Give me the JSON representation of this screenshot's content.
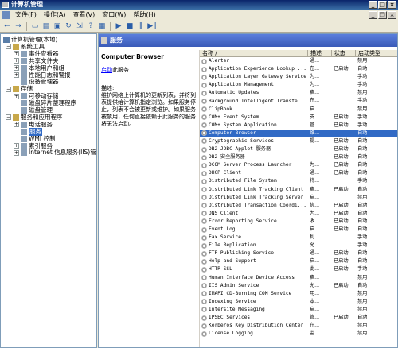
{
  "window": {
    "title": "计算机管理"
  },
  "menubar": {
    "items": [
      "文件(F)",
      "操作(A)",
      "查看(V)",
      "窗口(W)",
      "帮助(H)"
    ]
  },
  "tree": {
    "items": [
      {
        "label": "计算机管理(本地)",
        "expander": "",
        "level": 0
      },
      {
        "label": "系统工具",
        "expander": "−",
        "level": 1
      },
      {
        "label": "事件查看器",
        "expander": "+",
        "level": 2
      },
      {
        "label": "共享文件夹",
        "expander": "+",
        "level": 2
      },
      {
        "label": "本地用户和组",
        "expander": "+",
        "level": 2
      },
      {
        "label": "性能日志和警报",
        "expander": "+",
        "level": 2
      },
      {
        "label": "设备管理器",
        "expander": "",
        "level": 2
      },
      {
        "label": "存储",
        "expander": "−",
        "level": 1
      },
      {
        "label": "可移动存储",
        "expander": "+",
        "level": 2
      },
      {
        "label": "磁盘碎片整理程序",
        "expander": "",
        "level": 2
      },
      {
        "label": "磁盘管理",
        "expander": "",
        "level": 2
      },
      {
        "label": "服务和应用程序",
        "expander": "−",
        "level": 1
      },
      {
        "label": "电话服务",
        "expander": "+",
        "level": 2
      },
      {
        "label": "服务",
        "expander": "",
        "level": 2,
        "selected": true
      },
      {
        "label": "WMI 控制",
        "expander": "",
        "level": 2
      },
      {
        "label": "索引服务",
        "expander": "+",
        "level": 2
      },
      {
        "label": "Internet 信息服务(IIS)管",
        "expander": "+",
        "level": 2
      }
    ]
  },
  "pane": {
    "title": "服务"
  },
  "description": {
    "service_name": "Computer Browser",
    "start_link": "启动",
    "start_suffix": "此服务",
    "label": "描述:",
    "text": "维护网络上计算机的更新列表，并将列表提供给计算机指定浏览。如果服务停止，列表不会被更新或维护。如果服务被禁用，任何直接依赖于此服务的服务将无法启动。"
  },
  "list": {
    "headers": {
      "name": "名称 /",
      "desc": "描述",
      "status": "状态",
      "startup": "启动类型"
    },
    "rows": [
      {
        "name": "Alerter",
        "desc": "通...",
        "status": "",
        "startup": "禁用"
      },
      {
        "name": "Application Experience Lookup ...",
        "desc": "在...",
        "status": "已启动",
        "startup": "自动"
      },
      {
        "name": "Application Layer Gateway Service",
        "desc": "为...",
        "status": "",
        "startup": "手动"
      },
      {
        "name": "Application Management",
        "desc": "为...",
        "status": "",
        "startup": "手动"
      },
      {
        "name": "Automatic Updates",
        "desc": "启...",
        "status": "",
        "startup": "禁用"
      },
      {
        "name": "Background Intelligent Transfe...",
        "desc": "在...",
        "status": "",
        "startup": "手动"
      },
      {
        "name": "ClipBook",
        "desc": "启...",
        "status": "",
        "startup": "禁用"
      },
      {
        "name": "COM+ Event System",
        "desc": "支...",
        "status": "已启动",
        "startup": "手动"
      },
      {
        "name": "COM+ System Application",
        "desc": "管...",
        "status": "已启动",
        "startup": "手动"
      },
      {
        "name": "Computer Browser",
        "desc": "维...",
        "status": "",
        "startup": "自动",
        "selected": true
      },
      {
        "name": "Cryptographic Services",
        "desc": "提...",
        "status": "已启动",
        "startup": "自动"
      },
      {
        "name": "DB2 JDBC Applet 服务器",
        "desc": "",
        "status": "已启动",
        "startup": "自动"
      },
      {
        "name": "DB2 安全服务器",
        "desc": "",
        "status": "已启动",
        "startup": "自动"
      },
      {
        "name": "DCOM Server Process Launcher",
        "desc": "为...",
        "status": "已启动",
        "startup": "自动"
      },
      {
        "name": "DHCP Client",
        "desc": "通...",
        "status": "已启动",
        "startup": "自动"
      },
      {
        "name": "Distributed File System",
        "desc": "将...",
        "status": "",
        "startup": "手动"
      },
      {
        "name": "Distributed Link Tracking Client",
        "desc": "启...",
        "status": "已启动",
        "startup": "自动"
      },
      {
        "name": "Distributed Link Tracking Server",
        "desc": "启...",
        "status": "",
        "startup": "禁用"
      },
      {
        "name": "Distributed Transaction Coordi...",
        "desc": "协...",
        "status": "已启动",
        "startup": "自动"
      },
      {
        "name": "DNS Client",
        "desc": "为...",
        "status": "已启动",
        "startup": "自动"
      },
      {
        "name": "Error Reporting Service",
        "desc": "收...",
        "status": "已启动",
        "startup": "自动"
      },
      {
        "name": "Event Log",
        "desc": "启...",
        "status": "已启动",
        "startup": "自动"
      },
      {
        "name": "Fax Service",
        "desc": "利...",
        "status": "",
        "startup": "手动"
      },
      {
        "name": "File Replication",
        "desc": "允...",
        "status": "",
        "startup": "手动"
      },
      {
        "name": "FTP Publishing Service",
        "desc": "通...",
        "status": "已启动",
        "startup": "自动"
      },
      {
        "name": "Help and Support",
        "desc": "启...",
        "status": "已启动",
        "startup": "自动"
      },
      {
        "name": "HTTP SSL",
        "desc": "此...",
        "status": "已启动",
        "startup": "手动"
      },
      {
        "name": "Human Interface Device Access",
        "desc": "启...",
        "status": "",
        "startup": "禁用"
      },
      {
        "name": "IIS Admin Service",
        "desc": "允...",
        "status": "已启动",
        "startup": "自动"
      },
      {
        "name": "IMAPI CD-Burning COM Service",
        "desc": "用...",
        "status": "",
        "startup": "禁用"
      },
      {
        "name": "Indexing Service",
        "desc": "本...",
        "status": "",
        "startup": "禁用"
      },
      {
        "name": "Intersite Messaging",
        "desc": "启...",
        "status": "",
        "startup": "禁用"
      },
      {
        "name": "IPSEC Services",
        "desc": "管...",
        "status": "已启动",
        "startup": "自动"
      },
      {
        "name": "Kerberos Key Distribution Center",
        "desc": "在...",
        "status": "",
        "startup": "禁用"
      },
      {
        "name": "License Logging",
        "desc": "监...",
        "status": "",
        "startup": "禁用"
      }
    ]
  }
}
